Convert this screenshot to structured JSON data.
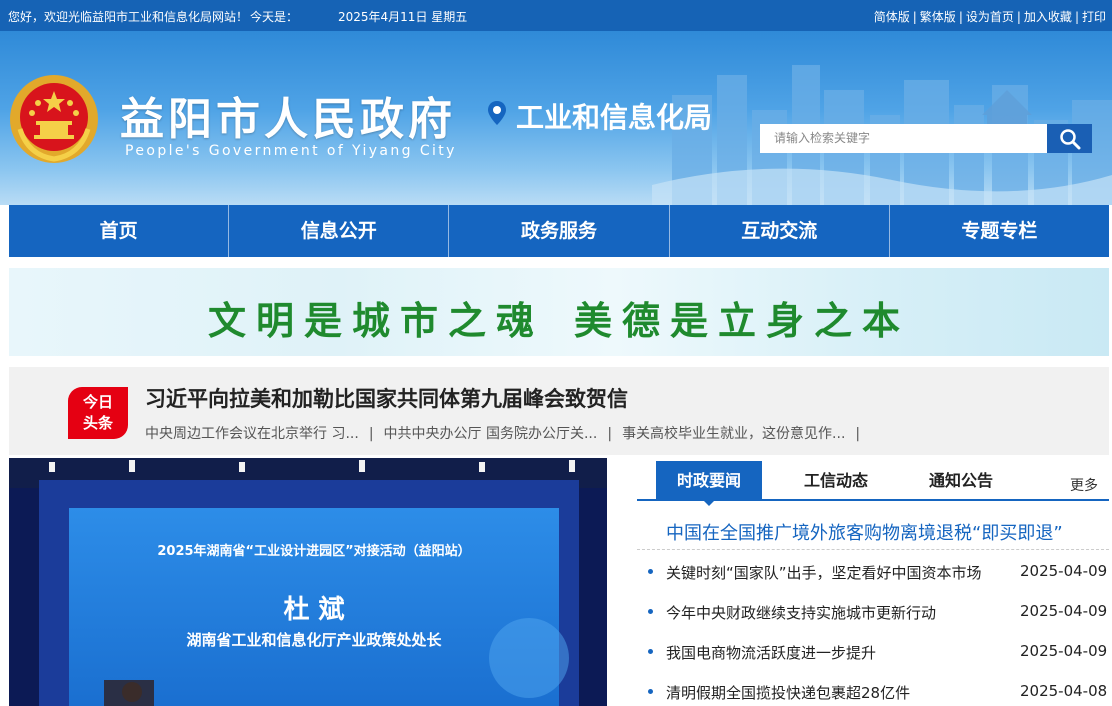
{
  "topbar": {
    "welcome": "您好，欢迎光临益阳市工业和信息化局网站！",
    "today_label": "今天是：",
    "date": "2025年4月11日  星期五",
    "links": [
      "简体版",
      "繁体版",
      "设为首页",
      "加入收藏",
      "打印"
    ]
  },
  "header": {
    "site_title": "益阳市人民政府",
    "site_subtitle": "People's Government of Yiyang City",
    "department": "工业和信息化局",
    "search_placeholder": "请输入检索关键字"
  },
  "nav": [
    "首页",
    "信息公开",
    "政务服务",
    "互动交流",
    "专题专栏"
  ],
  "banner": {
    "slogan_left": "文明是城市之魂",
    "slogan_right": "美德是立身之本"
  },
  "headline": {
    "badge_line1": "今日",
    "badge_line2": "头条",
    "title": "习近平向拉美和加勒比国家共同体第九届峰会致贺信",
    "subs": [
      "中央周边工作会议在北京举行 习...",
      "中共中央办公厅 国务院办公厅关...",
      "事关高校毕业生就业，这份意见作..."
    ]
  },
  "photo": {
    "event_title": "2025年湖南省“工业设计进园区”对接活动（益阳站）",
    "speaker_name": "杜  斌",
    "speaker_role": "湖南省工业和信息化厅产业政策处处长"
  },
  "news": {
    "tabs": [
      "时政要闻",
      "工信动态",
      "通知公告"
    ],
    "more": "更多",
    "top_story": "中国在全国推广境外旅客购物离境退税“即买即退”",
    "items": [
      {
        "title": "关键时刻“国家队”出手，坚定看好中国资本市场",
        "date": "2025-04-09"
      },
      {
        "title": "今年中央财政继续支持实施城市更新行动",
        "date": "2025-04-09"
      },
      {
        "title": "我国电商物流活跃度进一步提升",
        "date": "2025-04-09"
      },
      {
        "title": "清明假期全国揽投快递包裹超28亿件",
        "date": "2025-04-08"
      }
    ]
  },
  "colors": {
    "primary_blue": "#1565c0",
    "badge_red": "#e50012",
    "slogan_green": "#1f8a2e"
  }
}
